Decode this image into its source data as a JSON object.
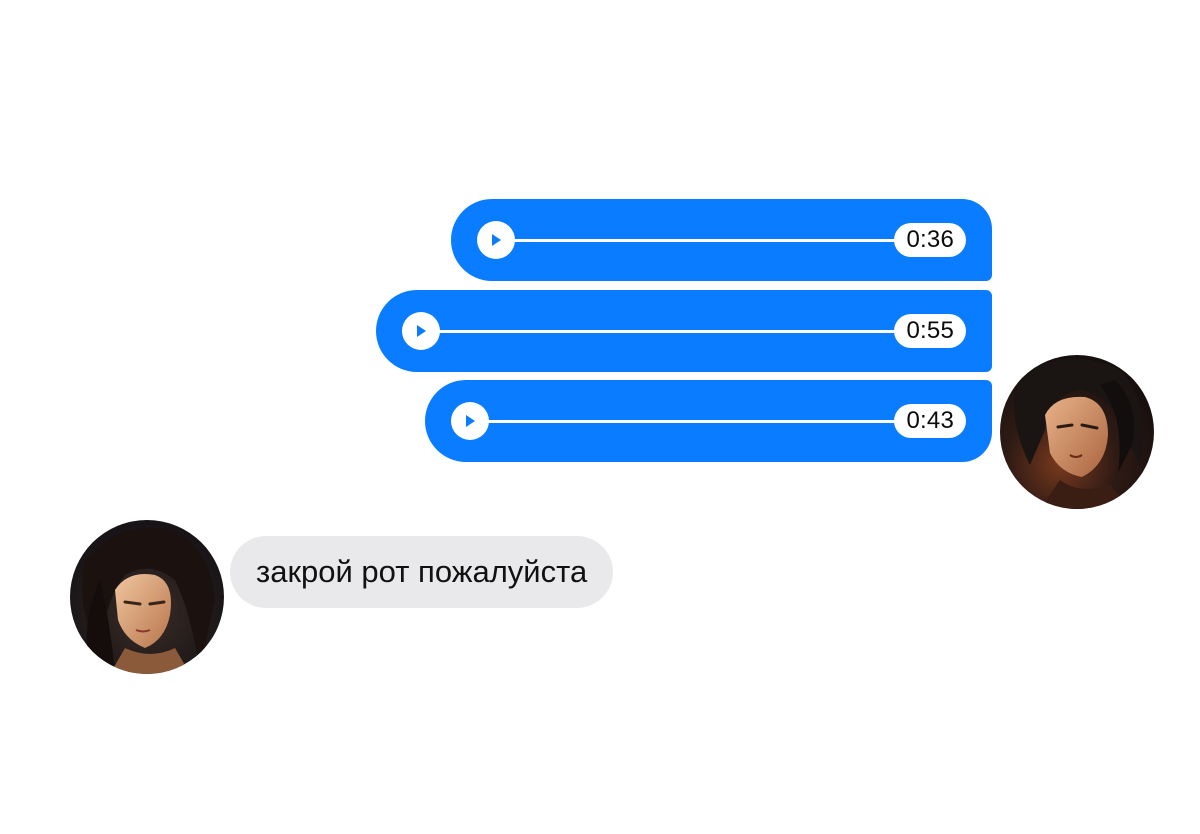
{
  "conversation": {
    "voice_messages": [
      {
        "duration": "0:36",
        "progress": 0
      },
      {
        "duration": "0:55",
        "progress": 0
      },
      {
        "duration": "0:43",
        "progress": 0
      }
    ],
    "incoming_message": {
      "text": "закрой рот пожалуйста"
    }
  },
  "colors": {
    "outgoing_bubble": "#0a7cff",
    "incoming_bubble": "#e9e9eb",
    "background": "#ffffff"
  },
  "icons": {
    "play": "play-icon"
  }
}
